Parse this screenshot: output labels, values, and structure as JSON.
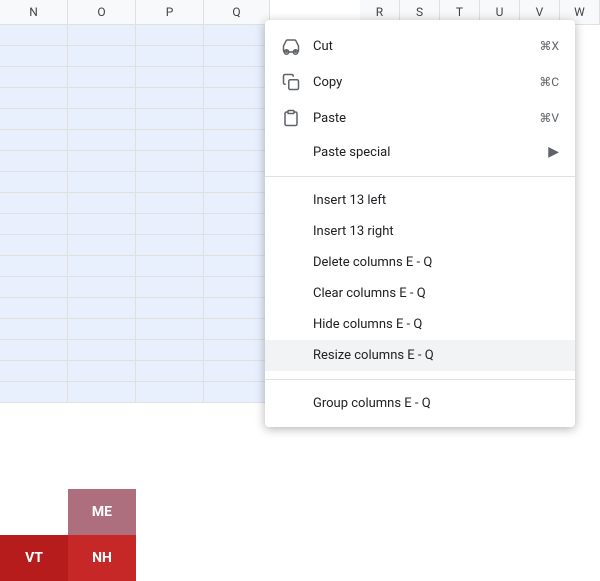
{
  "spreadsheet": {
    "col_headers": [
      "N",
      "O",
      "P",
      "Q"
    ],
    "right_headers": [
      "R",
      "S",
      "T",
      "U",
      "V",
      "W"
    ],
    "map_cells": {
      "vt": "VT",
      "nh": "NH",
      "me": "ME"
    }
  },
  "context_menu": {
    "items": [
      {
        "id": "cut",
        "icon": "scissors",
        "label": "Cut",
        "shortcut": "⌘X",
        "has_submenu": false,
        "highlighted": false
      },
      {
        "id": "copy",
        "icon": "copy",
        "label": "Copy",
        "shortcut": "⌘C",
        "has_submenu": false,
        "highlighted": false
      },
      {
        "id": "paste",
        "icon": "paste",
        "label": "Paste",
        "shortcut": "⌘V",
        "has_submenu": false,
        "highlighted": false
      },
      {
        "id": "paste-special",
        "icon": null,
        "label": "Paste special",
        "shortcut": null,
        "has_submenu": true,
        "highlighted": false
      },
      {
        "id": "divider1",
        "type": "divider"
      },
      {
        "id": "insert-left",
        "icon": null,
        "label": "Insert 13 left",
        "shortcut": null,
        "has_submenu": false,
        "highlighted": false
      },
      {
        "id": "insert-right",
        "icon": null,
        "label": "Insert 13 right",
        "shortcut": null,
        "has_submenu": false,
        "highlighted": false
      },
      {
        "id": "delete-cols",
        "icon": null,
        "label": "Delete columns E - Q",
        "shortcut": null,
        "has_submenu": false,
        "highlighted": false
      },
      {
        "id": "clear-cols",
        "icon": null,
        "label": "Clear columns E - Q",
        "shortcut": null,
        "has_submenu": false,
        "highlighted": false
      },
      {
        "id": "hide-cols",
        "icon": null,
        "label": "Hide columns E - Q",
        "shortcut": null,
        "has_submenu": false,
        "highlighted": false
      },
      {
        "id": "resize-cols",
        "icon": null,
        "label": "Resize columns E - Q",
        "shortcut": null,
        "has_submenu": false,
        "highlighted": true
      },
      {
        "id": "divider2",
        "type": "divider"
      },
      {
        "id": "group-cols",
        "icon": null,
        "label": "Group columns E - Q",
        "shortcut": null,
        "has_submenu": false,
        "highlighted": false
      }
    ]
  }
}
